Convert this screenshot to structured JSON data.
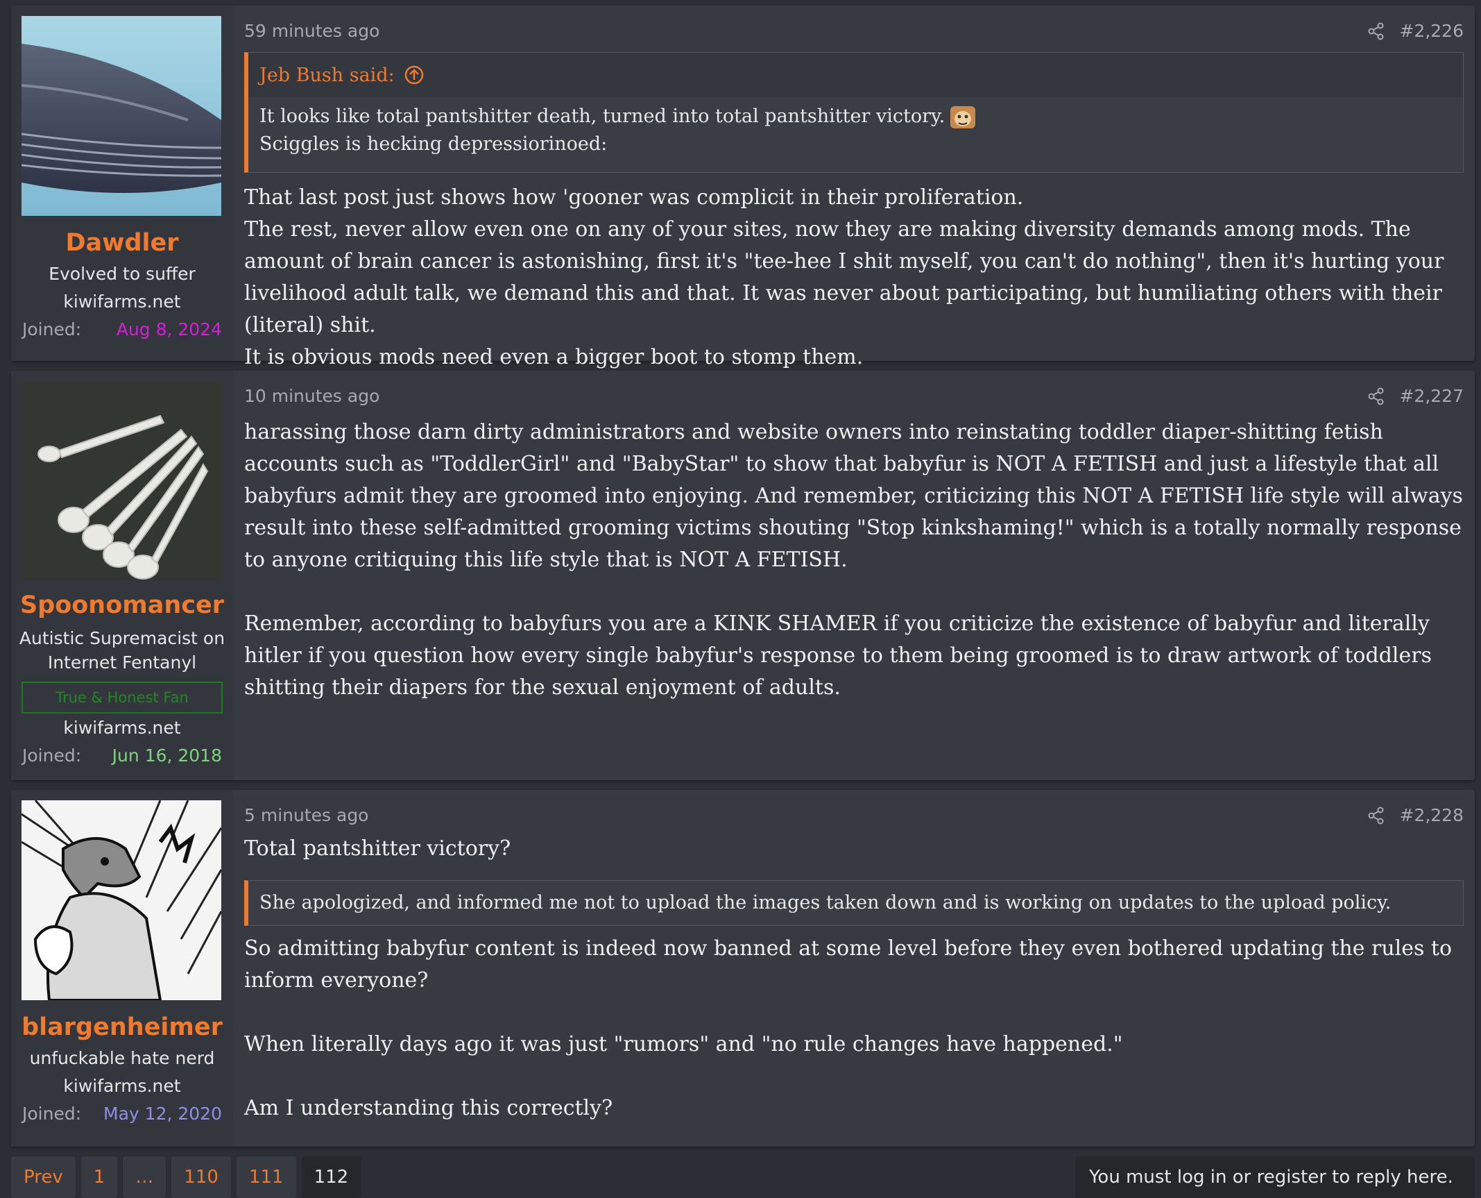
{
  "posts": [
    {
      "username": "Dawdler",
      "user_title": "Evolved to suffer",
      "site": "kiwifarms.net",
      "joined_label": "Joined:",
      "joined_date": "Aug 8, 2024",
      "joined_color": "#d321d3",
      "time": "59 minutes ago",
      "post_number": "#2,226",
      "quote": {
        "author": "Jeb Bush said:",
        "line1": "It looks like total pantshitter death, turned into total pantshitter victory.",
        "line2": "Sciggles is hecking depressiorinoed:"
      },
      "body": [
        "That last post just shows how 'gooner was complicit in their proliferation.",
        "The rest, never allow even one on any of your sites, now they are making diversity demands among mods. The amount of brain cancer is astonishing, first it's \"tee-hee I shit myself, you can't do nothing\", then it's hurting your livelihood adult talk, we demand this and that. It was never about participating, but humiliating others with their (literal) shit.",
        "It is obvious mods need even a bigger boot to stomp them."
      ]
    },
    {
      "username": "Spoonomancer",
      "user_title": "Autistic Supremacist on Internet Fentanyl",
      "banner": "True & Honest Fan",
      "site": "kiwifarms.net",
      "joined_label": "Joined:",
      "joined_date": "Jun 16, 2018",
      "joined_color": "#7fd37f",
      "time": "10 minutes ago",
      "post_number": "#2,227",
      "body": [
        "harassing those darn dirty administrators and website owners into reinstating toddler diaper-shitting fetish accounts such as \"ToddlerGirl\" and \"BabyStar\" to show that babyfur is NOT A FETISH and just a lifestyle that all babyfurs admit they are groomed into enjoying. And remember, criticizing this NOT A FETISH life style will always result into these self-admitted grooming victims shouting \"Stop kinkshaming!\" which is a totally normally response to anyone critiquing this life style that is NOT A FETISH.",
        "Remember, according to babyfurs you are a KINK SHAMER if you criticize the existence of babyfur and literally hitler if you question how every single babyfur's response to them being groomed is to draw artwork of toddlers shitting their diapers for the sexual enjoyment of adults."
      ]
    },
    {
      "username": "blargenheimer",
      "user_title": "unfuckable hate nerd",
      "site": "kiwifarms.net",
      "joined_label": "Joined:",
      "joined_date": "May 12, 2020",
      "joined_color": "#8f8fe8",
      "time": "5 minutes ago",
      "post_number": "#2,228",
      "body_top": "Total pantshitter victory?",
      "quote_text": "She apologized, and informed me not to upload the images taken down and is working on updates to the upload policy.",
      "body": [
        "So admitting babyfur content is indeed now banned at some level before they even bothered updating the rules to inform everyone?",
        "When literally days ago it was just \"rumors\" and \"no rule changes have happened.\"",
        "Am I understanding this correctly?"
      ]
    }
  ],
  "pagination": {
    "prev": "Prev",
    "pages": [
      "1",
      "…",
      "110",
      "111",
      "112"
    ]
  },
  "login_notice": "You must log in or register to reply here."
}
